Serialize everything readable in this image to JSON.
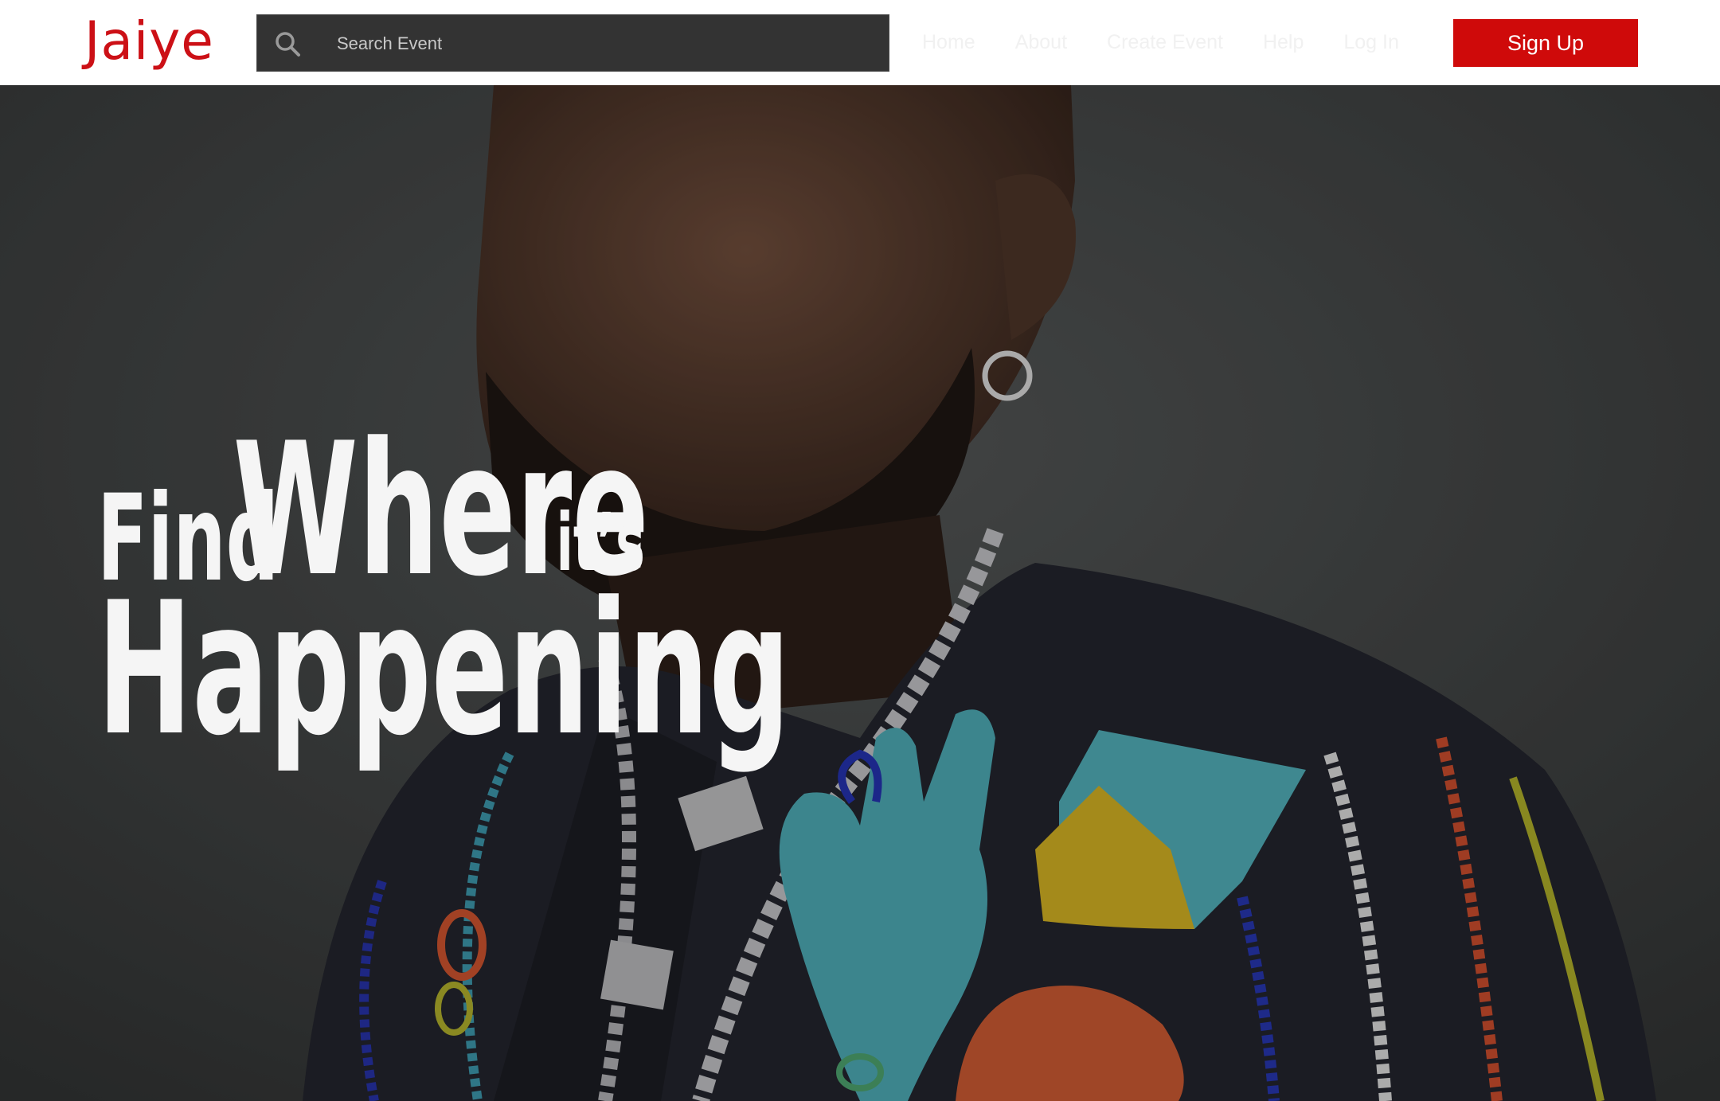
{
  "brand": {
    "logo_text": "Jaiye",
    "accent_color": "#cc1016"
  },
  "search": {
    "placeholder": "Search Event",
    "icon": "search-icon"
  },
  "nav": {
    "items": [
      {
        "label": "Home"
      },
      {
        "label": "About"
      },
      {
        "label": "Create Event"
      },
      {
        "label": "Help"
      },
      {
        "label": "Log In"
      }
    ]
  },
  "signup": {
    "label": "Sign Up",
    "color": "#cf0a0a"
  },
  "hero": {
    "headline": {
      "word1": "Find",
      "word2": "Where",
      "word3": "it’s",
      "word4": "Happening"
    }
  }
}
